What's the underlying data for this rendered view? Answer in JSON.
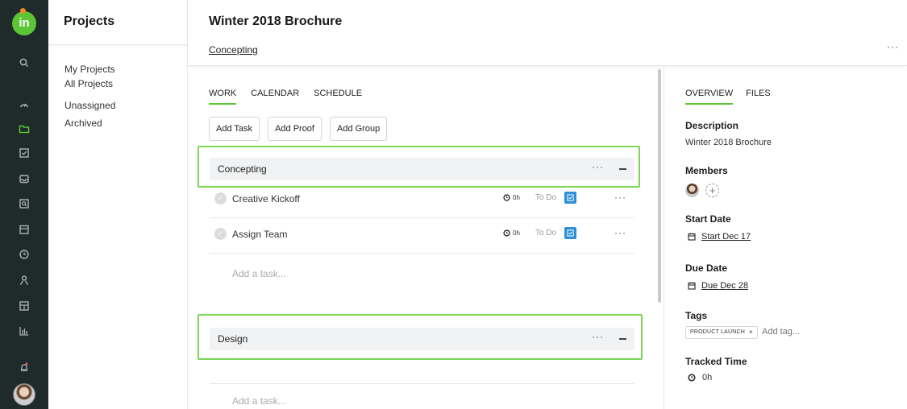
{
  "app": {
    "logo_text": "in",
    "user_avatar": "user-avatar"
  },
  "rail": {
    "icons": [
      "search-icon",
      "dashboard-gauge-icon",
      "folder-icon",
      "tasks-check-icon",
      "inbox-icon",
      "proof-review-icon",
      "calendar-icon",
      "clock-icon",
      "user-icon",
      "grid-icon",
      "reports-bars-icon",
      "notifications-bell-icon"
    ],
    "accent": "#5cc534"
  },
  "projects_nav": {
    "title": "Projects",
    "links": [
      "My Projects",
      "All Projects",
      "Unassigned",
      "Archived"
    ]
  },
  "header": {
    "title": "Winter 2018 Brochure",
    "breadcrumb": "Concepting",
    "more": "···"
  },
  "main": {
    "tabs": [
      {
        "label": "WORK",
        "active": true
      },
      {
        "label": "CALENDAR",
        "active": false
      },
      {
        "label": "SCHEDULE",
        "active": false
      }
    ],
    "buttons": {
      "add_task": "Add Task",
      "add_proof": "Add Proof",
      "add_group": "Add Group"
    },
    "groups": [
      {
        "name": "Concepting",
        "tasks": [
          {
            "name": "Creative Kickoff",
            "time": "0h",
            "status": "To Do"
          },
          {
            "name": "Assign Team",
            "time": "0h",
            "status": "To Do"
          }
        ],
        "add_placeholder": "Add a task..."
      },
      {
        "name": "Design",
        "tasks": [],
        "add_placeholder": "Add a task..."
      }
    ],
    "dots": "···",
    "highlight_color": "#7cd653",
    "status_color": "#2d8fd7"
  },
  "side": {
    "tabs": [
      {
        "label": "OVERVIEW",
        "active": true
      },
      {
        "label": "FILES",
        "active": false
      }
    ],
    "description_label": "Description",
    "description_value": "Winter 2018 Brochure",
    "members_label": "Members",
    "member_add": "+",
    "start_label": "Start Date",
    "start_value": "Start Dec 17",
    "due_label": "Due Date",
    "due_value": "Due Dec 28",
    "tags_label": "Tags",
    "tag": "PRODUCT LAUNCH",
    "tag_remove": "×",
    "tag_placeholder": "Add tag...",
    "tracked_label": "Tracked Time",
    "tracked_value": "0h"
  }
}
